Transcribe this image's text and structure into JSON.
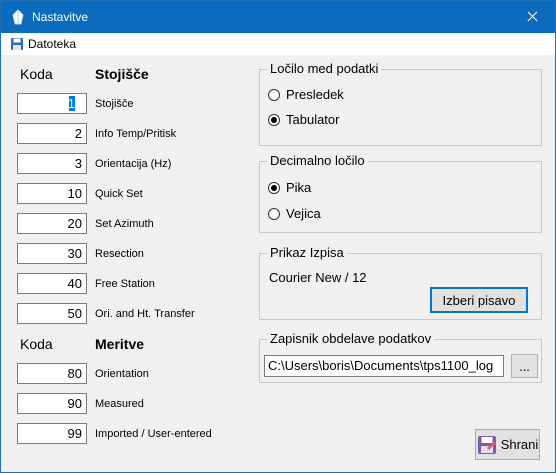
{
  "window": {
    "title": "Nastavitve",
    "accent": "#0b6bbf"
  },
  "menu": {
    "file_label": "Datoteka"
  },
  "left": {
    "koda_label_1": "Koda",
    "stojisce_header": "Stojišče",
    "stojisce_rows": [
      {
        "value": "1",
        "label": "Stojišče"
      },
      {
        "value": "2",
        "label": "Info Temp/Pritisk"
      },
      {
        "value": "3",
        "label": "Orientacija (Hz)"
      },
      {
        "value": "10",
        "label": "Quick Set"
      },
      {
        "value": "20",
        "label": "Set Azimuth"
      },
      {
        "value": "30",
        "label": "Resection"
      },
      {
        "value": "40",
        "label": "Free Station"
      },
      {
        "value": "50",
        "label": "Ori. and Ht. Transfer"
      }
    ],
    "koda_label_2": "Koda",
    "meritve_header": "Meritve",
    "meritve_rows": [
      {
        "value": "80",
        "label": "Orientation"
      },
      {
        "value": "90",
        "label": "Measured"
      },
      {
        "value": "99",
        "label": "Imported / User-entered"
      }
    ]
  },
  "delimiter_group": {
    "title": "Ločilo med podatki",
    "options": [
      {
        "label": "Presledek",
        "checked": false
      },
      {
        "label": "Tabulator",
        "checked": true
      }
    ]
  },
  "decimal_group": {
    "title": "Decimalno ločilo",
    "options": [
      {
        "label": "Pika",
        "checked": true
      },
      {
        "label": "Vejica",
        "checked": false
      }
    ]
  },
  "display_group": {
    "title": "Prikaz Izpisa",
    "font_text": "Courier New / 12",
    "choose_font_label": "Izberi pisavo"
  },
  "log_group": {
    "title": "Zapisnik obdelave podatkov",
    "path_value": "C:\\Users\\boris\\Documents\\tps1100_log",
    "browse_label": "..."
  },
  "save_label": "Shrani"
}
